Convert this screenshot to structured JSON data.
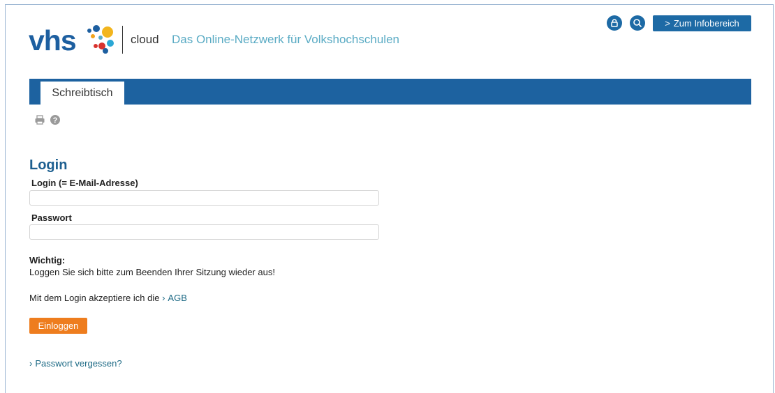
{
  "header": {
    "logo_text": "vhs",
    "cloud_label": "cloud",
    "tagline": "Das Online-Netzwerk für Volkshochschulen",
    "info_button_label": "Zum Infobereich",
    "info_button_chevron": ">"
  },
  "nav": {
    "tabs": [
      {
        "label": "Schreibtisch",
        "active": true
      }
    ]
  },
  "toolbar": {
    "icons": [
      "print-icon",
      "help-icon"
    ]
  },
  "login": {
    "title": "Login",
    "email_label": "Login (= E-Mail-Adresse)",
    "email_value": "",
    "password_label": "Passwort",
    "password_value": "",
    "notice_heading": "Wichtig:",
    "notice_text": "Loggen Sie sich bitte zum Beenden Ihrer Sitzung wieder aus!",
    "agb_prefix": "Mit dem Login akzeptiere ich die",
    "agb_link": "AGB",
    "submit_label": "Einloggen",
    "forgot_link": "Passwort vergessen?"
  },
  "colors": {
    "brand_blue": "#1d62a0",
    "accent_orange": "#ee7d1e",
    "tagline_teal": "#5aabc4"
  }
}
